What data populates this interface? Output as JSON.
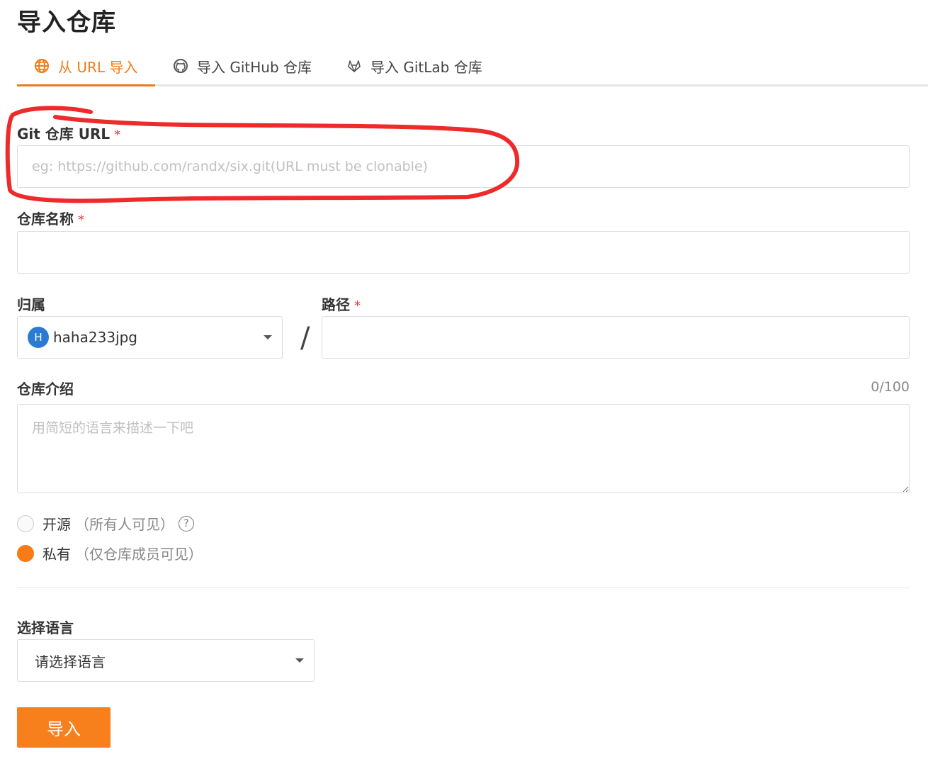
{
  "page": {
    "title": "导入仓库"
  },
  "tabs": [
    {
      "label": "从 URL 导入",
      "icon": "globe-icon",
      "active": true
    },
    {
      "label": "导入 GitHub 仓库",
      "icon": "github-icon",
      "active": false
    },
    {
      "label": "导入 GitLab 仓库",
      "icon": "gitlab-icon",
      "active": false
    }
  ],
  "form": {
    "git_url": {
      "label": "Git 仓库 URL",
      "required_mark": "*",
      "value": "",
      "placeholder": "eg: https://github.com/randx/six.git(URL must be clonable)"
    },
    "repo_name": {
      "label": "仓库名称",
      "required_mark": "*",
      "value": "",
      "placeholder": ""
    },
    "owner": {
      "label": "归属",
      "value": "haha233jpg",
      "avatar_letter": "H"
    },
    "path_separator": "/",
    "path": {
      "label": "路径",
      "required_mark": "*",
      "value": "",
      "placeholder": ""
    },
    "description": {
      "label": "仓库介绍",
      "counter": "0/100",
      "value": "",
      "placeholder": "用简短的语言来描述一下吧"
    },
    "visibility": {
      "options": [
        {
          "label": "开源",
          "hint": "（所有人可见）",
          "checked": false
        },
        {
          "label": "私有",
          "hint": "（仅仓库成员可见）",
          "checked": true
        }
      ],
      "help_symbol": "?"
    },
    "language": {
      "label": "选择语言",
      "value": "请选择语言"
    },
    "submit_label": "导入"
  },
  "colors": {
    "accent": "#f07b16",
    "required": "#e53935",
    "annotation": "#ee2a2a",
    "avatar": "#2b7bd4"
  }
}
